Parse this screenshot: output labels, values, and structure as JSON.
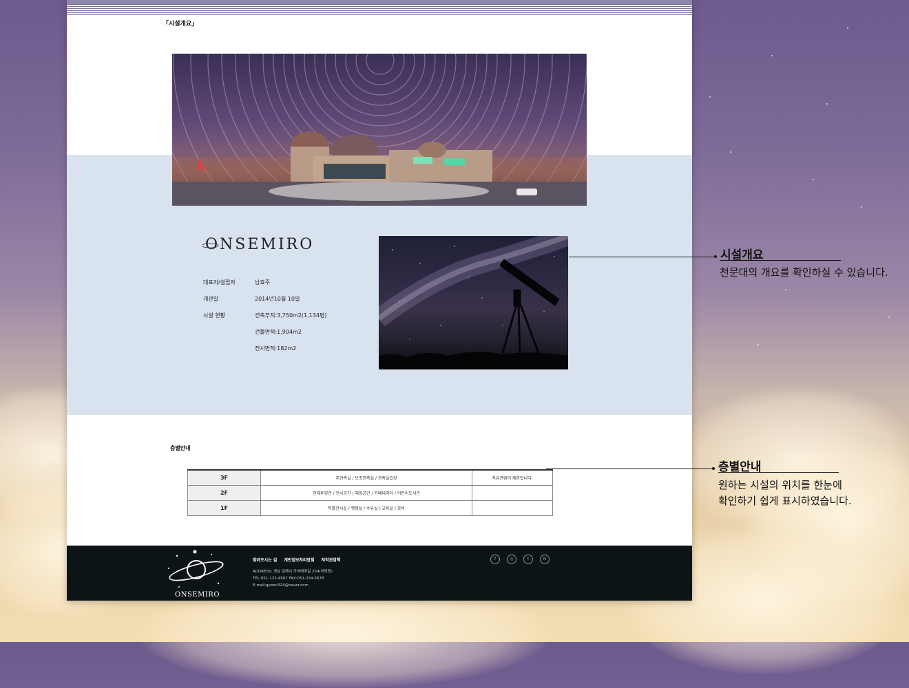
{
  "overview": {
    "section_label": "「시설개요」",
    "logo_text": "ONSEMIRO",
    "info_rows": [
      {
        "label": "대표자/설립자",
        "value": "남효주"
      },
      {
        "label": "개관일",
        "value": "2014년10월 10일"
      },
      {
        "label": "시설 현황",
        "value": "건축부지:3,750m2(1,134평)"
      },
      {
        "label": "",
        "value": "건물면적:1,904m2"
      },
      {
        "label": "",
        "value": "전시면적:182m2"
      }
    ]
  },
  "floors": {
    "section_label": "층별안내",
    "rows": [
      {
        "floor": "3F",
        "facilities": "주관측실 / 보조관측실 / 관측실습장",
        "note": "자유관람이 제한됩니다."
      },
      {
        "floor": "2F",
        "facilities": "천체투영관 / 전시공간 / 체험공간 / 카페테리아 / 어린이도서관",
        "note": ""
      },
      {
        "floor": "1F",
        "facilities": "특별전시실 / 행정실 / 수유실 / 교육실 / 로비",
        "note": ""
      }
    ]
  },
  "footer": {
    "logo_text": "ONSEMIRO",
    "links": [
      "찾아오시는 길",
      "개인정보처리방침",
      "저작권정책"
    ],
    "address": "ADDRESS: 경남 김해시 가야테마길 254(어방동)",
    "tel_fax": "TEL:051-123-4567    FAX:051-234-5678",
    "email": "E-mail:gyeen324@naver.com",
    "social_icons": [
      "facebook-icon",
      "instagram-icon",
      "twitter-icon",
      "naver-icon"
    ],
    "social_glyphs": [
      "f",
      "◎",
      "t",
      "N"
    ]
  },
  "annotations": [
    {
      "title": "시설개요",
      "desc": [
        "천문대의 개요를 확인하실 수 있습니다."
      ]
    },
    {
      "title": "층별안내",
      "desc": [
        "원하는 시설의 위치를 한눈에",
        "확인하기 쉽게 표시하였습니다."
      ]
    }
  ],
  "colors": {
    "band": "#d8e3ef",
    "footer": "#0d1417",
    "accent_stripe": "#7a6f9c"
  }
}
